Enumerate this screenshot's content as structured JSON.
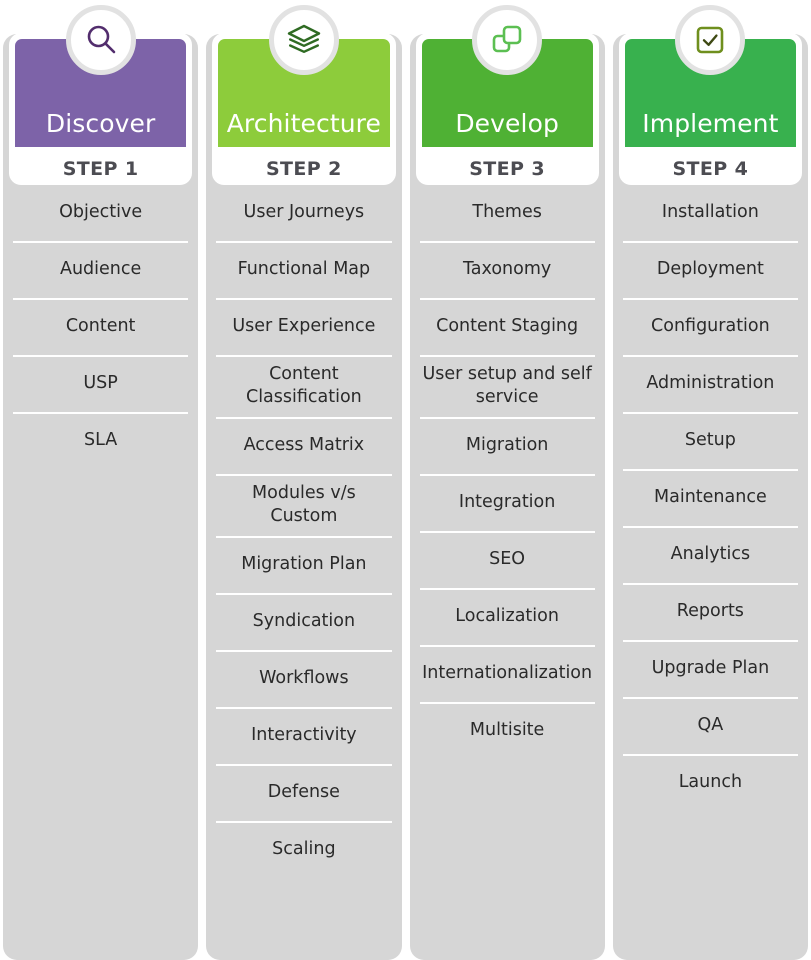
{
  "board": {
    "background_color": "#ffffff",
    "column_background": "#d6d6d6",
    "divider_color": "#ffffff",
    "step_text_color": "#4c4c52",
    "item_text_color": "#2a2a2a"
  },
  "columns": [
    {
      "title": "Discover",
      "step": "STEP 1",
      "accent_color": "#7d63a8",
      "icon": "search-icon",
      "icon_color": "#522d6d",
      "items": [
        "Objective",
        "Audience",
        "Content",
        "USP",
        "SLA"
      ]
    },
    {
      "title": "Architecture",
      "step": "STEP 2",
      "accent_color": "#8dcc3b",
      "icon": "layers-icon",
      "icon_color": "#2f6b23",
      "items": [
        "User Journeys",
        "Functional Map",
        "User Experience",
        "Content Classification",
        "Access Matrix",
        "Modules v/s Custom",
        "Migration Plan",
        "Syndication",
        "Workflows",
        "Interactivity",
        "Defense",
        "Scaling"
      ]
    },
    {
      "title": "Develop",
      "step": "STEP 3",
      "accent_color": "#4fb134",
      "icon": "duplicate-squares-icon",
      "icon_color": "#5cbf52",
      "items": [
        "Themes",
        "Taxonomy",
        "Content Staging",
        "User setup and self service",
        "Migration",
        "Integration",
        "SEO",
        "Localization",
        "Internationalization",
        "Multisite"
      ]
    },
    {
      "title": "Implement",
      "step": "STEP 4",
      "accent_color": "#38b14e",
      "icon": "checkbox-check-icon",
      "icon_color": "#6f8f1e",
      "items": [
        "Installation",
        "Deployment",
        "Configuration",
        "Administration",
        "Setup",
        "Maintenance",
        "Analytics",
        "Reports",
        "Upgrade Plan",
        "QA",
        "Launch"
      ]
    }
  ]
}
